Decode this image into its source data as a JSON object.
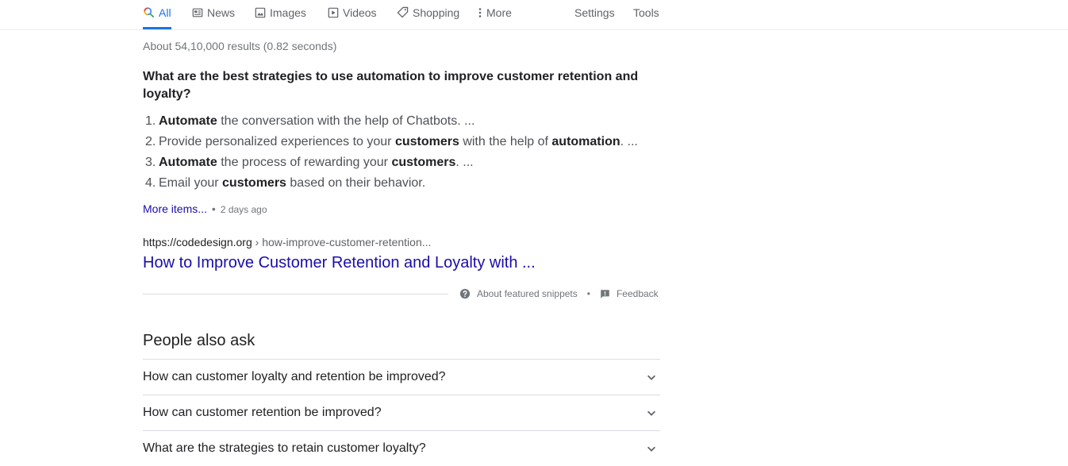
{
  "tabs": [
    {
      "label": "All",
      "icon": "search-icon",
      "active": true
    },
    {
      "label": "News",
      "icon": "news-icon"
    },
    {
      "label": "Images",
      "icon": "images-icon"
    },
    {
      "label": "Videos",
      "icon": "videos-icon"
    },
    {
      "label": "Shopping",
      "icon": "shopping-tag-icon"
    },
    {
      "label": "More",
      "icon": "more-vertical-icon"
    }
  ],
  "tools": {
    "settings": "Settings",
    "tools": "Tools"
  },
  "result_stats": "About 54,10,000 results (0.82 seconds)",
  "featured_snippet": {
    "question": "What are the best strategies to use automation to improve customer retention and loyalty?",
    "items": [
      {
        "number": "1.",
        "parts": [
          {
            "b": "Automate"
          },
          {
            "t": " the conversation with the help of Chatbots. ..."
          }
        ]
      },
      {
        "number": "2.",
        "parts": [
          {
            "t": "Provide personalized experiences to your "
          },
          {
            "b": "customers"
          },
          {
            "t": " with the help of "
          },
          {
            "b": "automation"
          },
          {
            "t": ". ..."
          }
        ]
      },
      {
        "number": "3.",
        "parts": [
          {
            "b": "Automate"
          },
          {
            "t": " the process of rewarding your "
          },
          {
            "b": "customers"
          },
          {
            "t": ". ..."
          }
        ]
      },
      {
        "number": "4.",
        "parts": [
          {
            "t": "Email your "
          },
          {
            "b": "customers"
          },
          {
            "t": " based on their behavior."
          }
        ]
      }
    ],
    "more_items": "More items...",
    "separator": "•",
    "date": "2 days ago",
    "cite_domain": "https://codedesign.org",
    "cite_path": " › how-improve-customer-retention...",
    "title": "How to Improve Customer Retention and Loyalty with ...",
    "about_label": "About featured snippets",
    "footer_dot": "•",
    "feedback_label": "Feedback"
  },
  "people_also_ask": {
    "title": "People also ask",
    "questions": [
      "How can customer loyalty and retention be improved?",
      "How can customer retention be improved?",
      "What are the strategies to retain customer loyalty?"
    ]
  },
  "colors": {
    "accent": "#1a73e8",
    "link": "#1a0dab",
    "muted": "#70757a"
  }
}
